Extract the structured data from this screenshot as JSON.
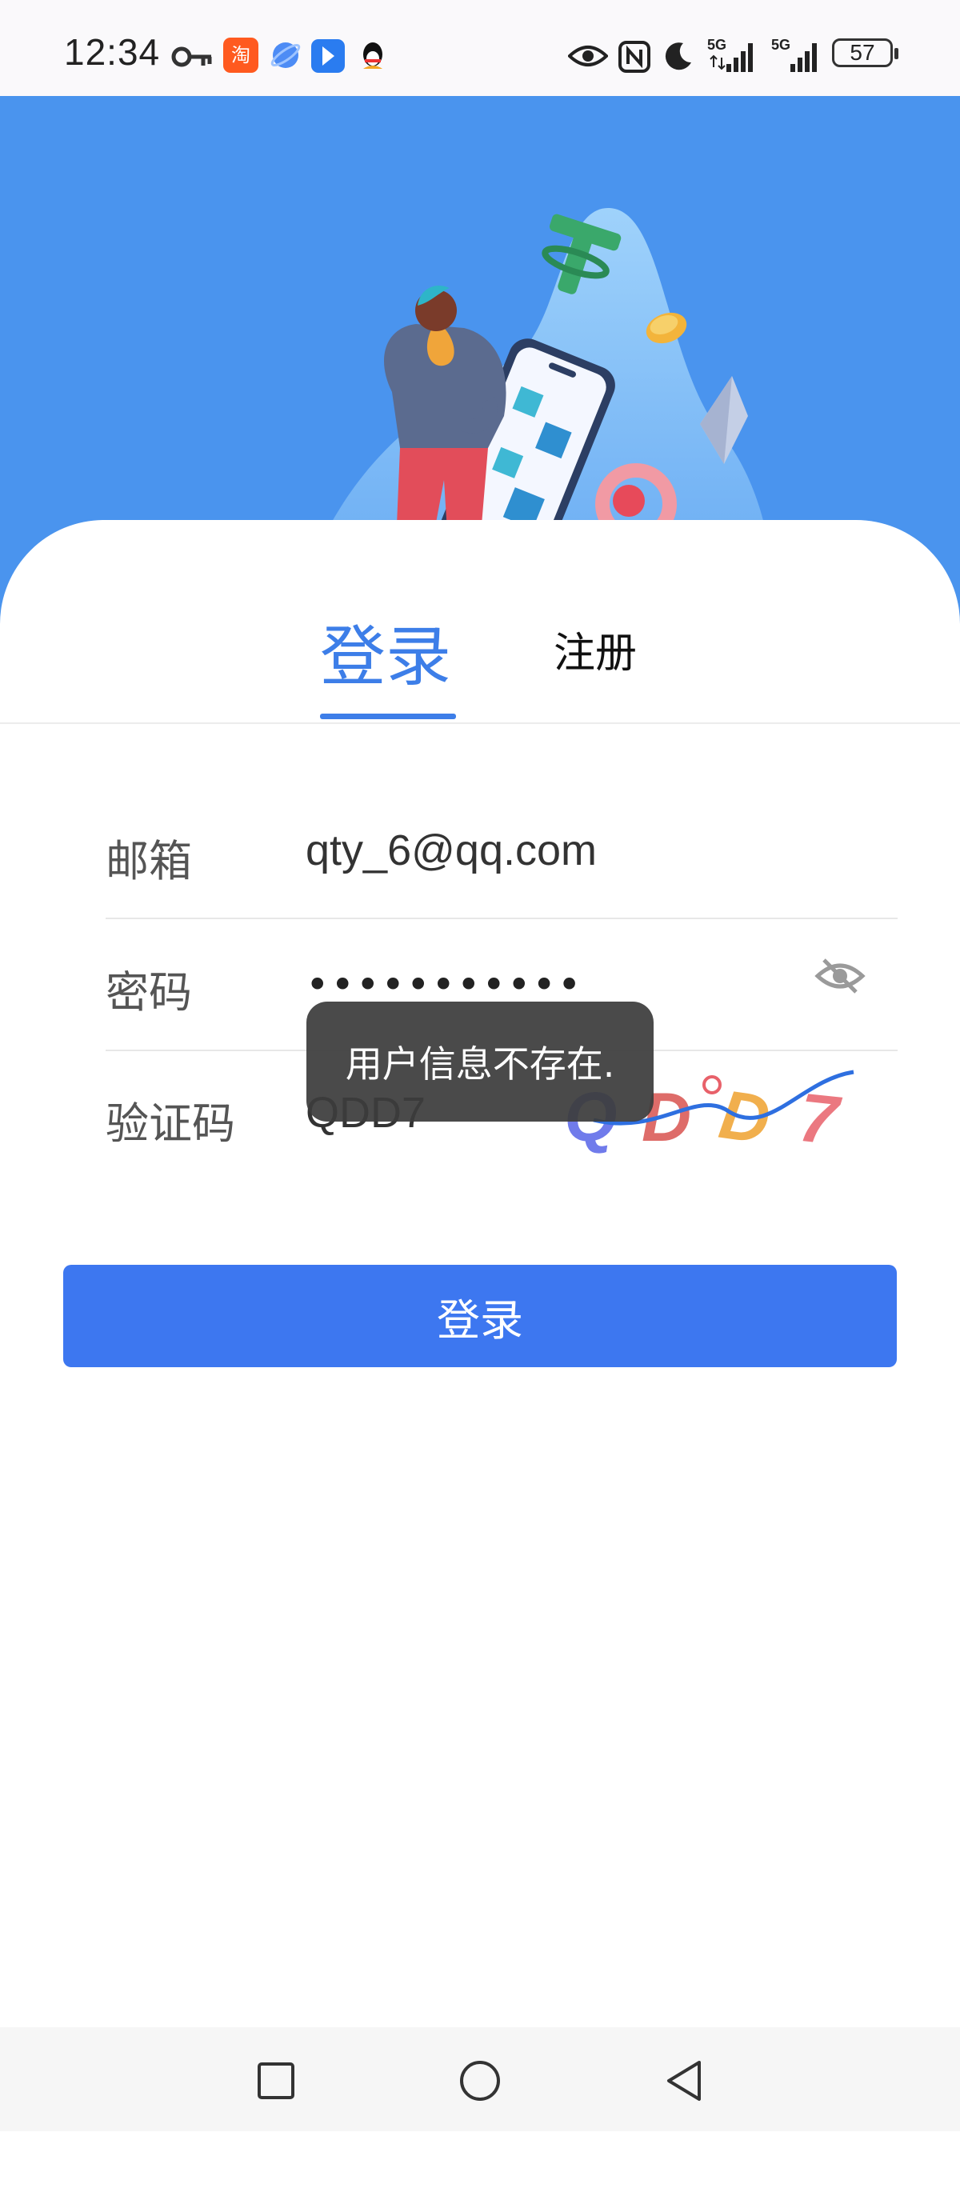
{
  "status_bar": {
    "time": "12:34",
    "icons": [
      "key-icon",
      "taobao-app-icon",
      "browser-app-icon",
      "blue-arrow-app-icon",
      "qq-app-icon",
      "eye-icon",
      "nfc-icon",
      "moon-icon",
      "signal-5g-icon",
      "signal-5g-icon"
    ],
    "network_1": "5G",
    "network_2": "5G",
    "battery": "57"
  },
  "hero": {
    "background_color": "#4a94ee",
    "illustration": "person-with-phone-illustration"
  },
  "tabs": [
    {
      "label": "登录",
      "active": true
    },
    {
      "label": "注册",
      "active": false
    }
  ],
  "form": {
    "email": {
      "label": "邮箱",
      "value": "qty_6@qq.com"
    },
    "password": {
      "label": "密码",
      "value": "•••••••••••"
    },
    "captcha": {
      "label": "验证码",
      "value": "QDD7",
      "image_text": "QDD7"
    }
  },
  "toast": {
    "message": "用户信息不存在."
  },
  "submit_button": {
    "label": "登录",
    "color": "#3d77f0"
  },
  "accent_color": "#3d7ee8"
}
